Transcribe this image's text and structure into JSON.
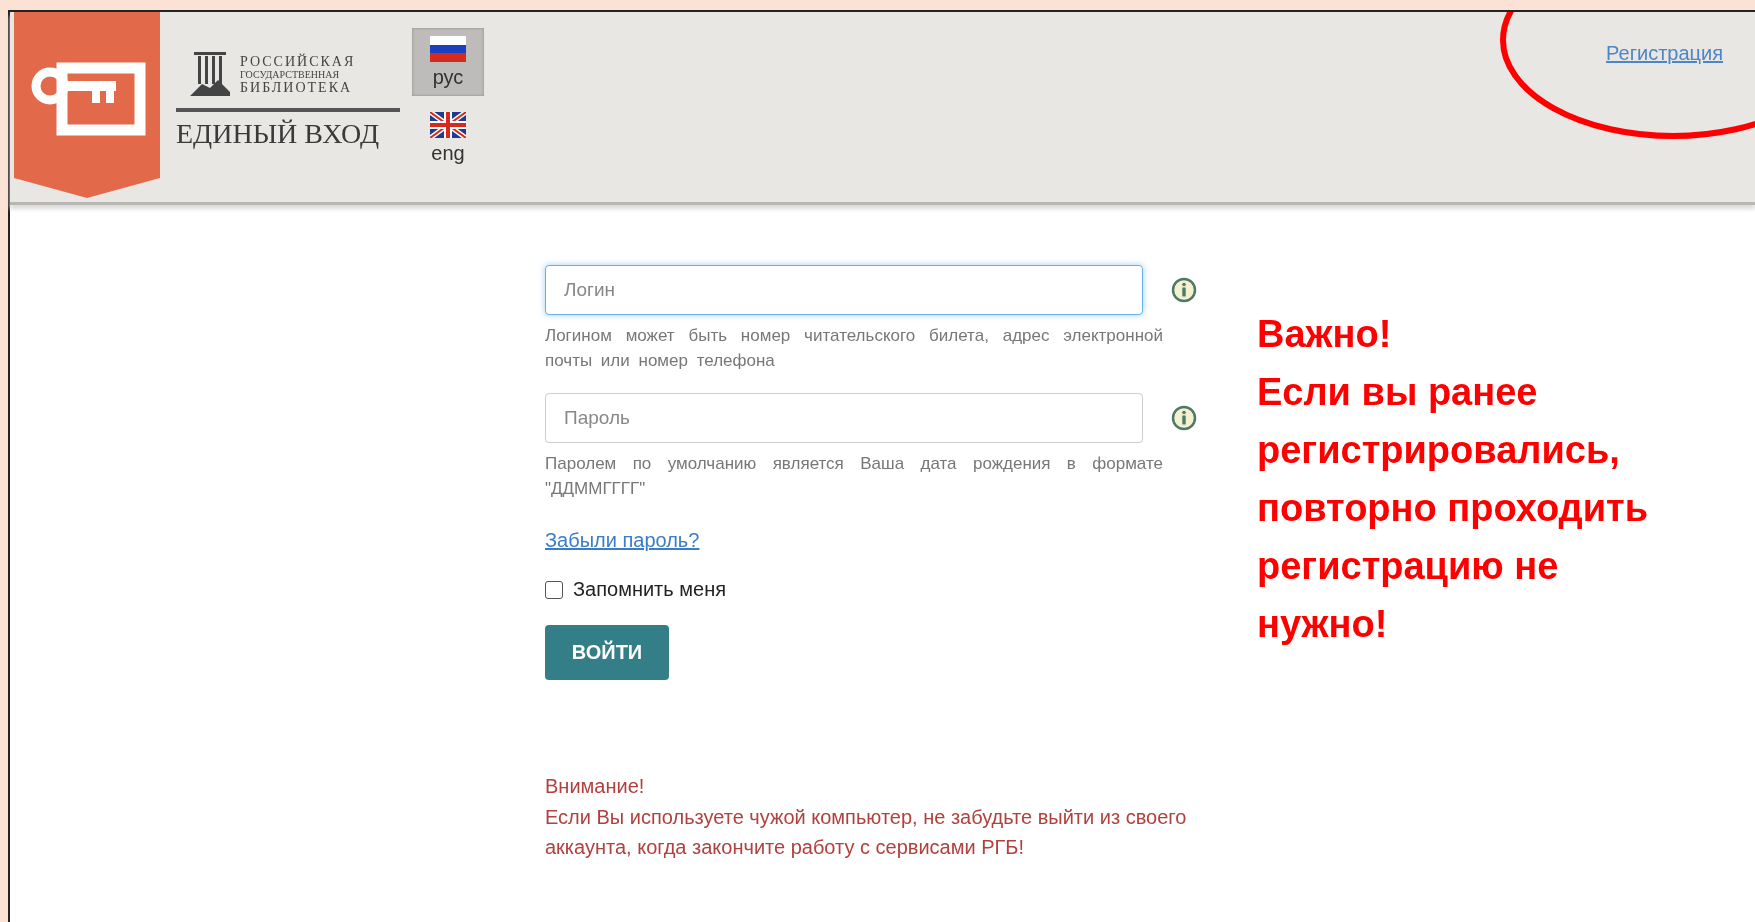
{
  "header": {
    "logo_lines": [
      "РОССИЙСКАЯ",
      "ГОСУДАРСТВЕННАЯ",
      "БИБЛИОТЕКА"
    ],
    "service_title": "ЕДИНЫЙ ВХОД",
    "languages": [
      {
        "label": "рус",
        "kind": "russia",
        "selected": true
      },
      {
        "label": "eng",
        "kind": "uk",
        "selected": false
      }
    ],
    "register_link": "Регистрация"
  },
  "form": {
    "login": {
      "placeholder": "Логин",
      "focused": true,
      "hint": "Логином может быть номер читательского билета, адрес электронной почты или номер телефона"
    },
    "password": {
      "placeholder": "Пароль",
      "focused": false,
      "hint": "Паролем по умолчанию является Ваша дата рождения в формате \"ДДММГГГГ\""
    },
    "forgot_link": "Забыли пароль?",
    "remember": {
      "label": "Запомнить меня",
      "checked": false
    },
    "submit": "ВОЙТИ",
    "warning_title": "Внимание!",
    "warning_text": "Если Вы используете чужой компьютер, не забудьте выйти из своего аккаунта, когда закончите работу с сервисами РГБ!"
  },
  "callout": {
    "title": "Важно!",
    "lines": [
      "Если вы ранее",
      "регистрировались,",
      "повторно проходить",
      "регистрацию не",
      "нужно!"
    ]
  }
}
